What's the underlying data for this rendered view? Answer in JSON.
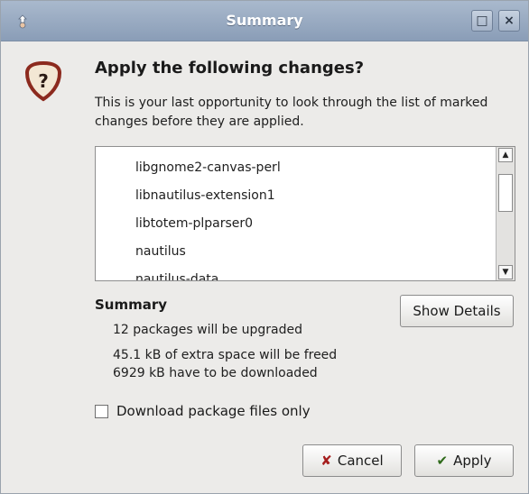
{
  "window": {
    "title": "Summary",
    "maximize_glyph": "□",
    "close_glyph": "×"
  },
  "dialog": {
    "icon": "question-icon",
    "heading": "Apply the following changes?",
    "description": "This is your last opportunity to look through the list of marked changes before they are applied."
  },
  "changes_list": {
    "items": [
      "libgnome2-canvas-perl",
      "libnautilus-extension1",
      "libtotem-plparser0",
      "nautilus",
      "nautilus-data"
    ]
  },
  "summary": {
    "label": "Summary",
    "upgraded": "12 packages will be upgraded",
    "space": "45.1 kB of extra space will be freed",
    "download": "6929 kB have to be downloaded",
    "show_details_label": "Show Details"
  },
  "options": {
    "download_only_label": "Download package files only",
    "download_only_checked": false
  },
  "buttons": {
    "cancel_label": "Cancel",
    "apply_label": "Apply"
  },
  "colors": {
    "titlebar": "#8a9db7",
    "cancel_icon": "#a51d1d",
    "apply_icon": "#2f6a1a",
    "question_icon": "#8c2a1e"
  }
}
